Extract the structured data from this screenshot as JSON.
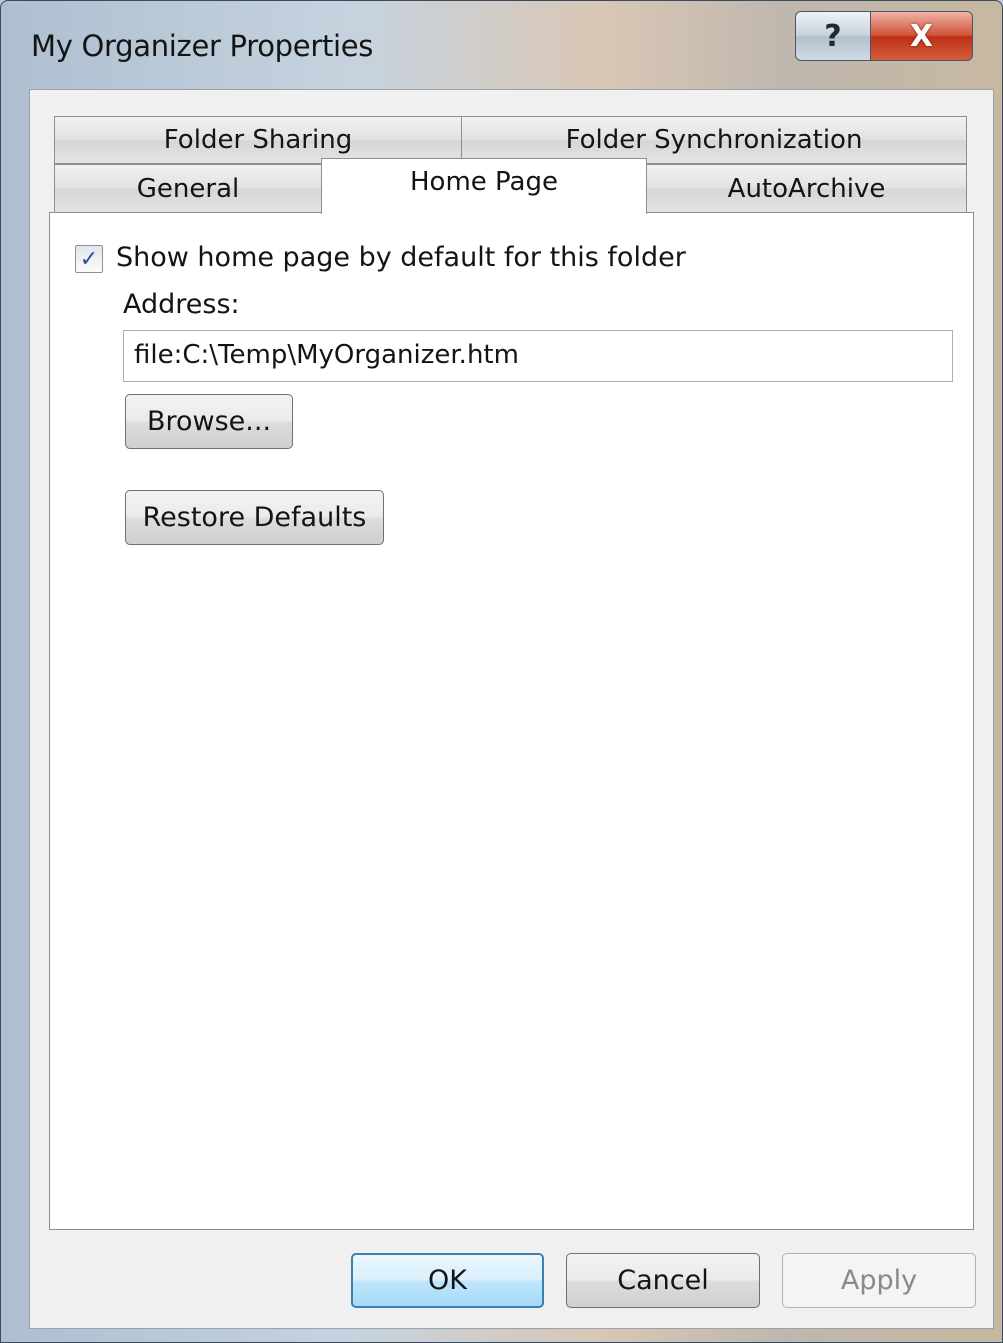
{
  "window": {
    "title": "My Organizer Properties",
    "help_label": "?",
    "close_label": "X"
  },
  "tabs": {
    "row_back": [
      {
        "label": "Folder Sharing"
      },
      {
        "label": "Folder Synchronization"
      }
    ],
    "row_front": [
      {
        "label": "General"
      },
      {
        "label": "Home Page",
        "active": true
      },
      {
        "label": "AutoArchive"
      }
    ]
  },
  "home_page": {
    "show_checkbox_checked": true,
    "check_glyph": "✓",
    "show_label": "Show home page by default for this folder",
    "address_label": "Address:",
    "address_value": "file:C:\\Temp\\MyOrganizer.htm",
    "browse_label": "Browse...",
    "restore_label": "Restore Defaults"
  },
  "footer": {
    "ok_label": "OK",
    "cancel_label": "Cancel",
    "apply_label": "Apply",
    "apply_enabled": false
  }
}
